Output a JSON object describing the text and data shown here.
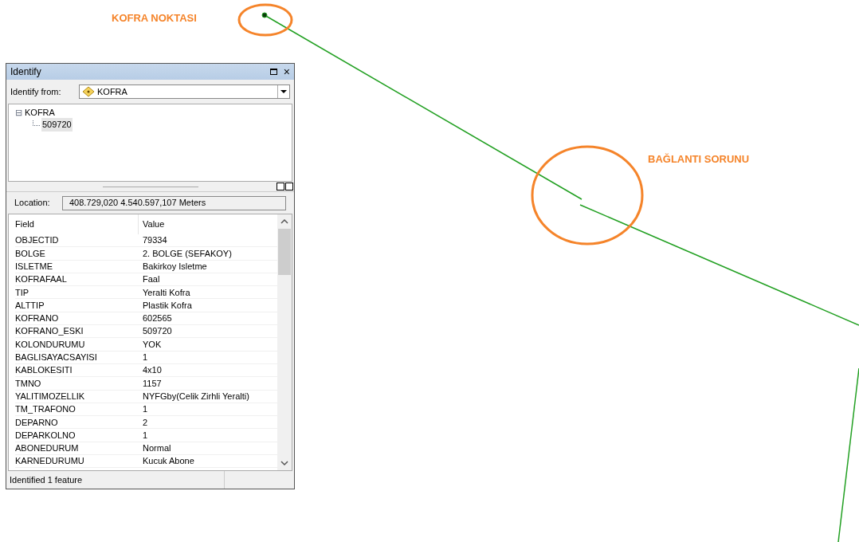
{
  "annotations": [
    {
      "text": "KOFRA NOKTASI"
    },
    {
      "text": "BAĞLANTI SORUNU"
    }
  ],
  "window": {
    "title": "Identify",
    "close": "×"
  },
  "identify_from": {
    "label": "Identify from:",
    "value": "KOFRA"
  },
  "tree": [
    {
      "label": "KOFRA",
      "expanded": true,
      "expander": "⊟",
      "children": [
        {
          "label": "509720",
          "selected": true
        }
      ]
    }
  ],
  "location": {
    "label": "Location:",
    "value": "408.729,020  4.540.597,107 Meters"
  },
  "table": {
    "columns": [
      "Field",
      "Value"
    ],
    "rows": [
      [
        "OBJECTID",
        "79334"
      ],
      [
        "BOLGE",
        "2. BOLGE (SEFAKOY)"
      ],
      [
        "ISLETME",
        "Bakirkoy Isletme"
      ],
      [
        "KOFRAFAAL",
        "Faal"
      ],
      [
        "TIP",
        "Yeralti Kofra"
      ],
      [
        "ALTTIP",
        "Plastik Kofra"
      ],
      [
        "KOFRANO",
        "602565"
      ],
      [
        "KOFRANO_ESKI",
        "509720"
      ],
      [
        "KOLONDURUMU",
        "YOK"
      ],
      [
        "BAGLISAYACSAYISI",
        "1"
      ],
      [
        "KABLOKESITI",
        "4x10"
      ],
      [
        "TMNO",
        "1157"
      ],
      [
        "YALITIMOZELLIK",
        "NYFGby(Celik Zirhli Yeralti)"
      ],
      [
        "TM_TRAFONO",
        "1"
      ],
      [
        "DEPARNO",
        "2"
      ],
      [
        "DEPARKOLNO",
        "1"
      ],
      [
        "ABONEDURUM",
        "Normal"
      ],
      [
        "KARNEDURUMU",
        "Kucuk Abone"
      ]
    ]
  },
  "status_bar": "Identified 1 feature"
}
